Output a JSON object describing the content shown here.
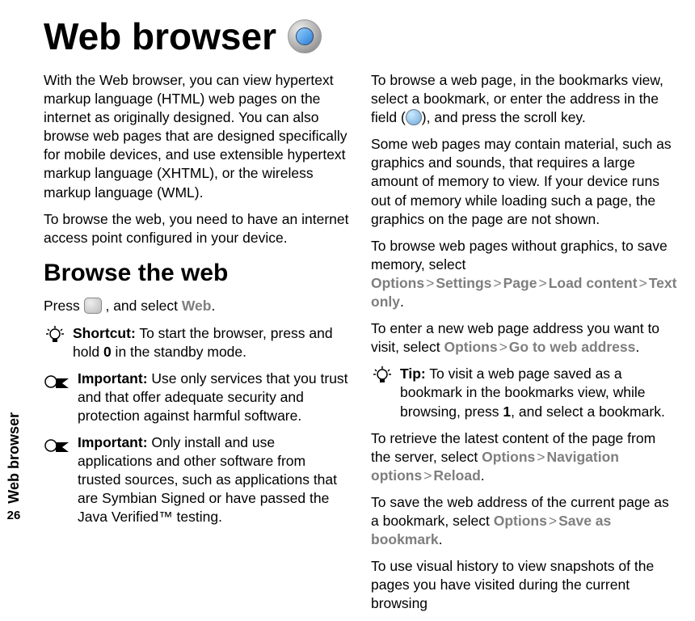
{
  "side_label": "Web browser",
  "page_number": "26",
  "title": "Web browser",
  "left": {
    "intro_1": "With the Web browser, you can view hypertext markup language (HTML) web pages on the internet as originally designed. You can also browse web pages that are designed specifically for mobile devices, and use extensible hypertext markup language (XHTML), or the wireless markup language (WML).",
    "intro_2": "To browse the web, you need to have an internet access point configured in your device.",
    "subhead": "Browse the web",
    "press_a": "Press ",
    "press_b": " , and select ",
    "press_web": "Web",
    "press_c": ".",
    "shortcut_label": "Shortcut:",
    "shortcut_a": " To start the browser, press and hold ",
    "shortcut_key": "0",
    "shortcut_b": " in the standby mode.",
    "important_label": "Important:",
    "important_1": "  Use only services that you trust and that offer adequate security and protection against harmful software.",
    "important_2": "  Only install and use applications and other software from trusted sources, such as applications that are Symbian Signed or have passed the Java Verified™ testing."
  },
  "right": {
    "p1_a": "To browse a web page, in the bookmarks view, select a bookmark, or enter the address in the field (",
    "p1_b": "), and press the scroll key.",
    "p2": "Some web pages may contain material, such as graphics and sounds, that requires a large amount of memory to view. If your device runs out of memory while loading such a page, the graphics on the page are not shown.",
    "p3_a": "To browse web pages without graphics, to save memory, select ",
    "p3_end": ".",
    "p4_a": "To enter a new web page address you want to visit, select ",
    "p4_end": ".",
    "tip_label": "Tip:",
    "tip_a": " To visit a web page saved as a bookmark in the bookmarks view, while browsing, press ",
    "tip_key": "1",
    "tip_b": ", and select a bookmark.",
    "p5_a": "To retrieve the latest content of the page from the server, select ",
    "p5_end": ".",
    "p6_a": "To save the web address of the current page as a bookmark, select ",
    "p6_end": ".",
    "p7": "To use visual history to view snapshots of the pages you have visited during the current browsing"
  },
  "opts": {
    "options": "Options",
    "settings": "Settings",
    "page": "Page",
    "load_content": "Load content",
    "text_only": "Text only",
    "go_to": "Go to web address",
    "nav": "Navigation options",
    "reload": "Reload",
    "save_bm": "Save as bookmark",
    "gt": ">"
  }
}
